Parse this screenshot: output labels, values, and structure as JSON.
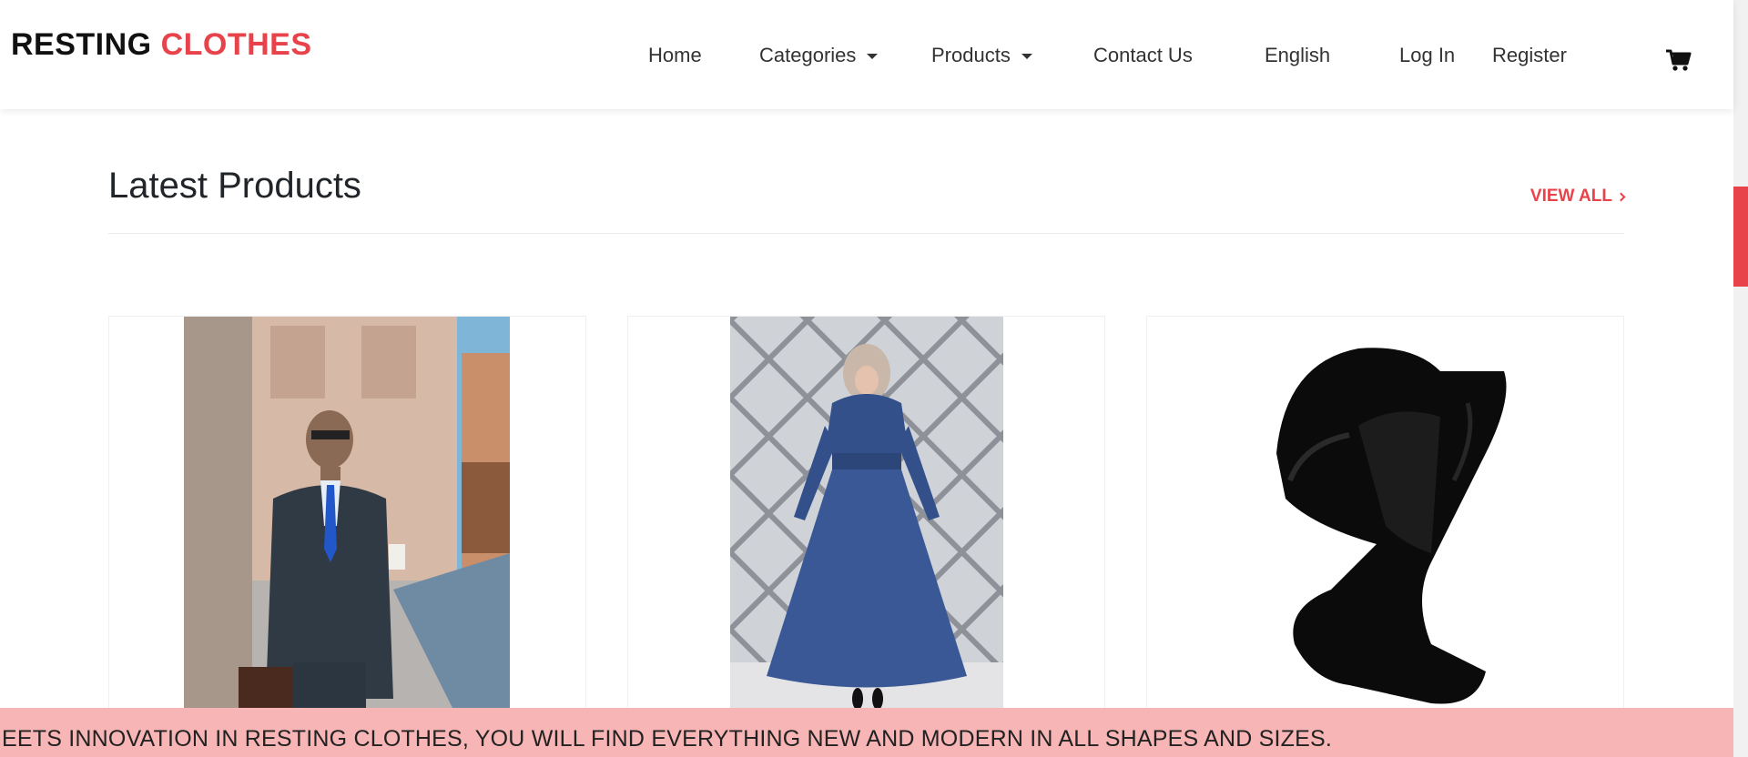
{
  "header": {
    "brand_part1": "RESTING",
    "brand_part2": "CLOTHES",
    "nav": {
      "home": "Home",
      "categories": "Categories",
      "products": "Products",
      "contact": "Contact Us",
      "language": "English",
      "login": "Log In",
      "register": "Register"
    },
    "cart_icon": "shopping-cart-icon"
  },
  "section": {
    "title": "Latest Products",
    "view_all": "VIEW ALL"
  },
  "products": [
    {
      "image": "man-in-suit-photo"
    },
    {
      "image": "blue-dress-photo"
    },
    {
      "image": "black-fur-scarf-photo"
    }
  ],
  "marquee": {
    "text": "EETS INNOVATION IN RESTING CLOTHES, YOU WILL FIND EVERYTHING NEW AND MODERN IN ALL SHAPES AND SIZES."
  },
  "colors": {
    "accent": "#e8434a",
    "marquee_bg": "#f8b5b5"
  }
}
